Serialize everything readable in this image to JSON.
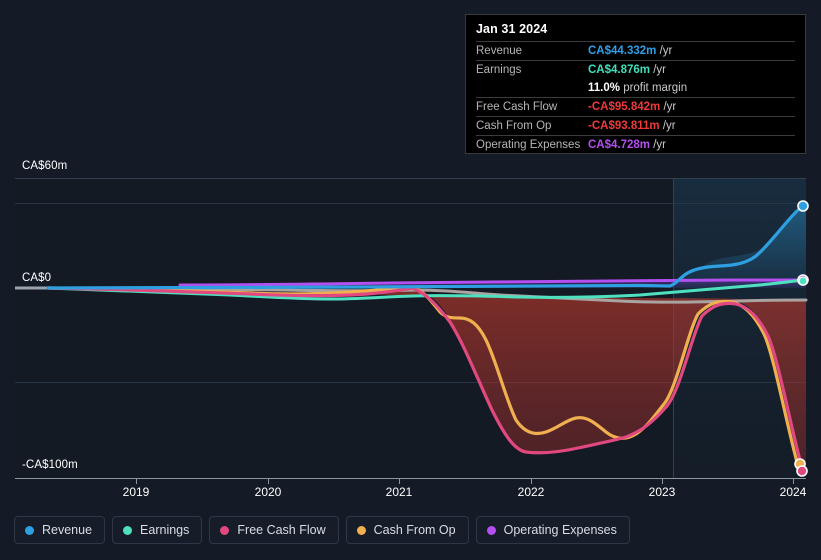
{
  "axis": {
    "y_labels": [
      {
        "text": "CA$60m",
        "y": 166
      },
      {
        "text": "CA$0",
        "y": 279
      },
      {
        "text": "-CA$100m",
        "y": 466
      }
    ],
    "x_labels": [
      "2019",
      "2020",
      "2021",
      "2022",
      "2023",
      "2024"
    ]
  },
  "tooltip": {
    "date": "Jan 31 2024",
    "rows": [
      {
        "label": "Revenue",
        "value": "CA$44.332m",
        "unit": "/yr",
        "color": "#2e9fe8"
      },
      {
        "label": "Earnings",
        "value": "CA$4.876m",
        "unit": "/yr",
        "color": "#3fe0bb"
      },
      {
        "label": "",
        "value": "11.0%",
        "unit": "profit margin",
        "color": "#ffffff"
      },
      {
        "label": "Free Cash Flow",
        "value": "-CA$95.842m",
        "unit": "/yr",
        "color": "#ef3a3a"
      },
      {
        "label": "Cash From Op",
        "value": "-CA$93.811m",
        "unit": "/yr",
        "color": "#ef3a3a"
      },
      {
        "label": "Operating Expenses",
        "value": "CA$4.728m",
        "unit": "/yr",
        "color": "#b44ff0"
      }
    ]
  },
  "legend": [
    {
      "label": "Revenue",
      "color": "#2e9fe0"
    },
    {
      "label": "Earnings",
      "color": "#4fe0c0"
    },
    {
      "label": "Free Cash Flow",
      "color": "#e0487f"
    },
    {
      "label": "Cash From Op",
      "color": "#f0b04f"
    },
    {
      "label": "Operating Expenses",
      "color": "#b44ff0"
    }
  ],
  "chart_data": {
    "type": "area",
    "title": "",
    "xlabel": "",
    "ylabel": "CA$",
    "currency": "CA$",
    "unit": "m",
    "ylim": [
      -110,
      60
    ],
    "y_ticks": [
      60,
      0,
      -100
    ],
    "grid": true,
    "legend_position": "bottom",
    "x": [
      "2019",
      "2020",
      "2021",
      "2022",
      "2023",
      "2024"
    ],
    "x_range": [
      "2018-06",
      "2024-01"
    ],
    "forecast_start": "2023-04",
    "series": [
      {
        "name": "Revenue",
        "color": "#2e9fe0",
        "final_value": 44.332,
        "final_label": "CA$44.332m",
        "points": [
          {
            "x": "2018-06",
            "y": 0.2
          },
          {
            "x": "2019-01",
            "y": 0.3
          },
          {
            "x": "2020-01",
            "y": 0.6
          },
          {
            "x": "2021-01",
            "y": 1.0
          },
          {
            "x": "2022-01",
            "y": 1.4
          },
          {
            "x": "2022-08",
            "y": 2.0
          },
          {
            "x": "2023-01",
            "y": 14.5
          },
          {
            "x": "2023-05",
            "y": 15.5
          },
          {
            "x": "2023-08",
            "y": 24.0
          },
          {
            "x": "2024-01",
            "y": 44.332
          }
        ]
      },
      {
        "name": "Earnings",
        "color": "#4fe0c0",
        "final_value": 4.876,
        "final_label": "CA$4.876m",
        "points": [
          {
            "x": "2018-06",
            "y": 0.0
          },
          {
            "x": "2019-01",
            "y": -1.5
          },
          {
            "x": "2020-01",
            "y": -4.0
          },
          {
            "x": "2020-08",
            "y": -5.5
          },
          {
            "x": "2021-01",
            "y": -4.0
          },
          {
            "x": "2022-01",
            "y": -4.5
          },
          {
            "x": "2023-01",
            "y": -3.0
          },
          {
            "x": "2023-08",
            "y": 0.5
          },
          {
            "x": "2024-01",
            "y": 4.876
          }
        ]
      },
      {
        "name": "Free Cash Flow",
        "color": "#e0487f",
        "final_value": -95.842,
        "final_label": "-CA$95.842m",
        "points": [
          {
            "x": "2018-06",
            "y": 0.0
          },
          {
            "x": "2019-06",
            "y": -1.5
          },
          {
            "x": "2020-01",
            "y": -3.0
          },
          {
            "x": "2020-06",
            "y": -6.0
          },
          {
            "x": "2021-01",
            "y": -1.0
          },
          {
            "x": "2021-04",
            "y": -15.0
          },
          {
            "x": "2021-08",
            "y": -55.0
          },
          {
            "x": "2022-02",
            "y": -88.0
          },
          {
            "x": "2022-08",
            "y": -89.0
          },
          {
            "x": "2023-02",
            "y": -40.0
          },
          {
            "x": "2023-07",
            "y": -8.0
          },
          {
            "x": "2023-10",
            "y": -15.0
          },
          {
            "x": "2024-01",
            "y": -95.842
          }
        ]
      },
      {
        "name": "Cash From Op",
        "color": "#f0b04f",
        "final_value": -93.811,
        "final_label": "-CA$93.811m",
        "points": [
          {
            "x": "2018-06",
            "y": 0.5
          },
          {
            "x": "2019-06",
            "y": -1.0
          },
          {
            "x": "2020-01",
            "y": -2.5
          },
          {
            "x": "2020-06",
            "y": -5.0
          },
          {
            "x": "2021-01",
            "y": -0.5
          },
          {
            "x": "2021-04",
            "y": -10.0
          },
          {
            "x": "2021-07",
            "y": -12.0
          },
          {
            "x": "2021-11",
            "y": -60.0
          },
          {
            "x": "2022-03",
            "y": -73.0
          },
          {
            "x": "2022-06",
            "y": -68.0
          },
          {
            "x": "2022-10",
            "y": -80.0
          },
          {
            "x": "2023-03",
            "y": -32.0
          },
          {
            "x": "2023-07",
            "y": -6.0
          },
          {
            "x": "2023-10",
            "y": -13.0
          },
          {
            "x": "2024-01",
            "y": -93.811
          }
        ]
      },
      {
        "name": "Operating Expenses",
        "color": "#b44ff0",
        "final_value": 4.728,
        "final_label": "CA$4.728m",
        "points": [
          {
            "x": "2019-09",
            "y": 3.2
          },
          {
            "x": "2020-06",
            "y": 3.4
          },
          {
            "x": "2021-01",
            "y": 3.8
          },
          {
            "x": "2021-10",
            "y": 4.6
          },
          {
            "x": "2022-06",
            "y": 4.4
          },
          {
            "x": "2023-02",
            "y": 4.3
          },
          {
            "x": "2023-08",
            "y": 4.6
          },
          {
            "x": "2024-01",
            "y": 4.728
          }
        ]
      },
      {
        "name": "Reference Line",
        "color": "#a9a3a1",
        "final_value": -6.5,
        "points": [
          {
            "x": "2018-06",
            "y": 0.3
          },
          {
            "x": "2019-06",
            "y": -0.5
          },
          {
            "x": "2020-06",
            "y": -1.5
          },
          {
            "x": "2021-02",
            "y": -1.0
          },
          {
            "x": "2021-10",
            "y": -3.5
          },
          {
            "x": "2022-06",
            "y": -4.5
          },
          {
            "x": "2023-02",
            "y": -6.5
          },
          {
            "x": "2024-01",
            "y": -6.5
          }
        ]
      }
    ]
  }
}
